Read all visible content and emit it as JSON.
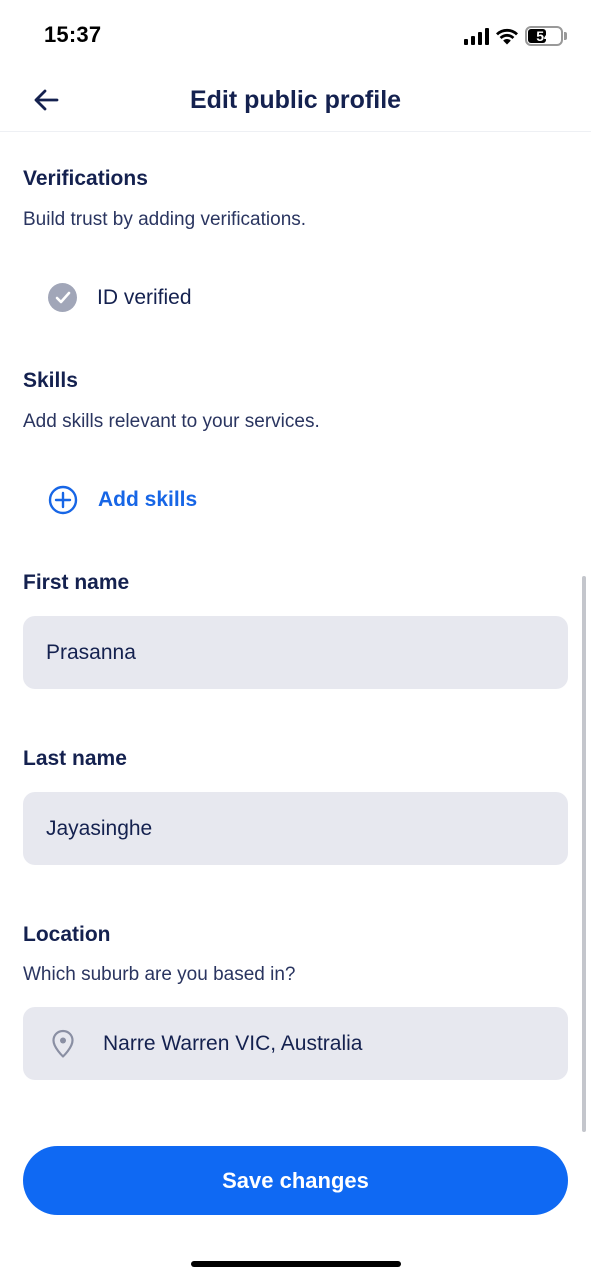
{
  "status_bar": {
    "time": "15:37",
    "battery": "54"
  },
  "header": {
    "title": "Edit public profile"
  },
  "verifications": {
    "title": "Verifications",
    "description": "Build trust by adding verifications.",
    "items": [
      {
        "label": "ID verified",
        "icon": "check-circle-icon"
      }
    ]
  },
  "skills": {
    "title": "Skills",
    "description": "Add skills relevant to your services.",
    "add_label": "Add skills"
  },
  "first_name": {
    "label": "First name",
    "value": "Prasanna"
  },
  "last_name": {
    "label": "Last name",
    "value": "Jayasinghe"
  },
  "location": {
    "label": "Location",
    "description": "Which suburb are you based in?",
    "value": "Narre Warren VIC, Australia"
  },
  "actions": {
    "save_label": "Save changes"
  },
  "colors": {
    "primary": "#0f69f3",
    "text": "#14214f",
    "input_bg": "#e7e8ef",
    "verified_icon": "#a1a6b8"
  }
}
